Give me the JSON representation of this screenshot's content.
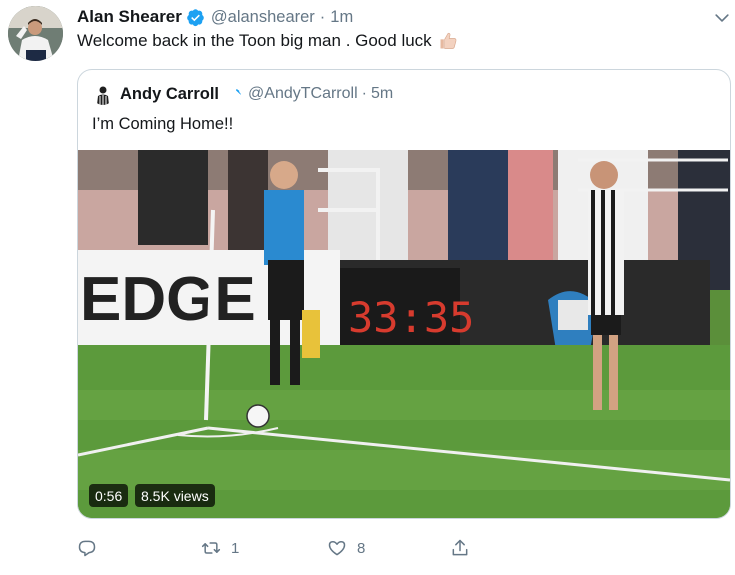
{
  "tweet": {
    "author_name": "Alan Shearer",
    "author_handle": "@alanshearer",
    "separator": "·",
    "time": "1m",
    "text": "Welcome back in the Toon big man . Good luck",
    "emoji": "thumbs-up-emoji"
  },
  "quoted_tweet": {
    "author_name": "Andy Carroll",
    "author_handle": "@AndyTCarroll",
    "separator": "·",
    "time": "5m",
    "text": "I’m Coming Home!!",
    "video": {
      "duration": "0:56",
      "views": "8.5K views",
      "board_text": "EDGE",
      "clock_text": "33:35"
    }
  },
  "actions": {
    "reply": {
      "icon": "reply-icon"
    },
    "retweet": {
      "icon": "retweet-icon",
      "count": "1"
    },
    "like": {
      "icon": "like-icon",
      "count": "8"
    },
    "share": {
      "icon": "share-icon"
    }
  },
  "colors": {
    "verified": "#1da1f2",
    "secondary_text": "#657786",
    "border": "#ccd6dd"
  }
}
